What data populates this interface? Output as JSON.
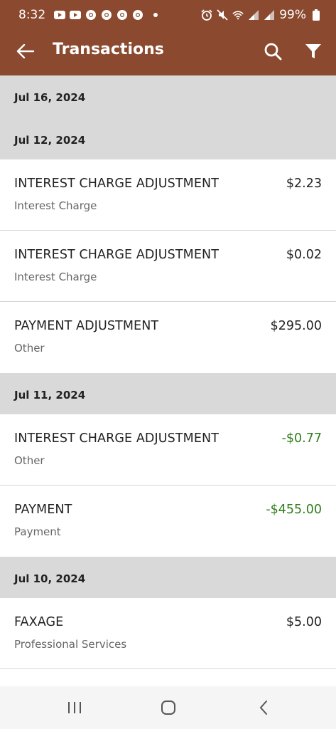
{
  "status_bar": {
    "time": "8:32",
    "notification_icons": [
      "youtube-icon",
      "youtube-icon",
      "chrome-icon",
      "chrome-icon",
      "chrome-icon",
      "chrome-icon"
    ],
    "right_icons": [
      "alarm-icon",
      "mute-icon",
      "wifi-icon",
      "signal-icon",
      "signal-icon",
      "battery-icon"
    ],
    "battery": "99%"
  },
  "app_bar": {
    "title": "Transactions",
    "back_icon": "back-arrow-icon",
    "search_icon": "search-icon",
    "filter_icon": "filter-icon"
  },
  "colors": {
    "header": "#8b4a2f",
    "date_band": "#d9d9d9",
    "negative_amount": "#2e7d1a"
  },
  "groups": [
    {
      "date": "Jul 16, 2024",
      "transactions": []
    },
    {
      "date": "Jul 12, 2024",
      "transactions": [
        {
          "name": "INTEREST CHARGE ADJUSTMENT",
          "category": "Interest Charge",
          "amount": "$2.23"
        },
        {
          "name": "INTEREST CHARGE ADJUSTMENT",
          "category": "Interest Charge",
          "amount": "$0.02"
        },
        {
          "name": "PAYMENT ADJUSTMENT",
          "category": "Other",
          "amount": "$295.00"
        }
      ]
    },
    {
      "date": "Jul 11, 2024",
      "transactions": [
        {
          "name": "INTEREST CHARGE ADJUSTMENT",
          "category": "Other",
          "amount": "-$0.77"
        },
        {
          "name": "PAYMENT",
          "category": "Payment",
          "amount": "-$455.00"
        }
      ]
    },
    {
      "date": "Jul 10, 2024",
      "transactions": [
        {
          "name": "FAXAGE",
          "category": "Professional Services",
          "amount": "$5.00"
        }
      ]
    }
  ],
  "nav_bar": {
    "recents_icon": "recents-icon",
    "home_icon": "home-icon",
    "back_icon": "back-icon"
  }
}
